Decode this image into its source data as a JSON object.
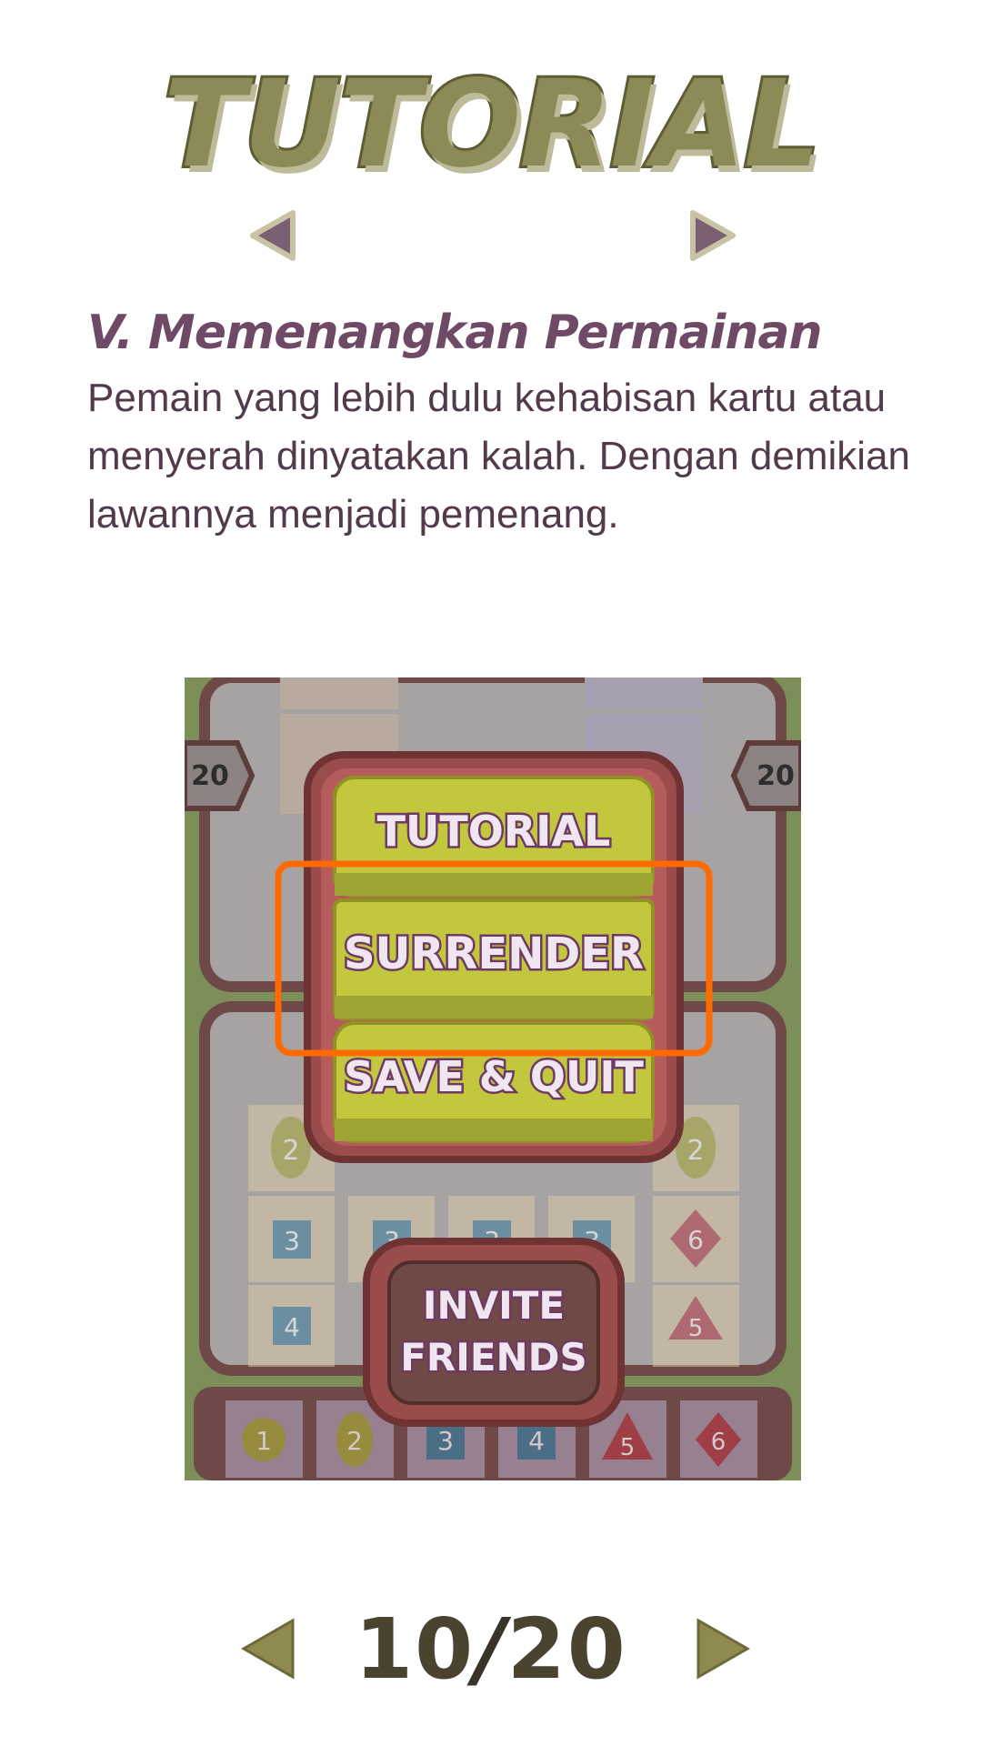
{
  "header": {
    "title": "TUTORIAL"
  },
  "section": {
    "heading": "V. Memenangkan Permainan",
    "body": "Pemain yang lebih dulu kehabisan kartu atau menyerah dinyatakan kalah. Dengan demikian lawannya menjadi pemenang."
  },
  "example": {
    "scores": {
      "left": "20",
      "right": "20"
    },
    "menu": {
      "tutorial_label": "TUTORIAL",
      "surrender_label": "SURRENDER",
      "save_quit_label": "SAVE & QUIT",
      "invite_line1": "INVITE",
      "invite_line2": "FRIENDS"
    },
    "highlight_color": "#ff6a00",
    "board_cards": {
      "row_ovals": [
        "2",
        "2"
      ],
      "row_squares": [
        "3",
        "3",
        "3",
        "3"
      ],
      "diamond": "6",
      "square4": "4",
      "triangle": "5",
      "hand": [
        "1",
        "2",
        "3",
        "4",
        "5",
        "6"
      ]
    }
  },
  "pagination": {
    "current": "10",
    "total": "20",
    "separator": "/"
  },
  "colors": {
    "accent": "#6f4a66",
    "title": "#8c8a56",
    "button": "#c2c73e"
  },
  "icons": {
    "prev": "triangle-left-icon",
    "next": "triangle-right-icon"
  }
}
